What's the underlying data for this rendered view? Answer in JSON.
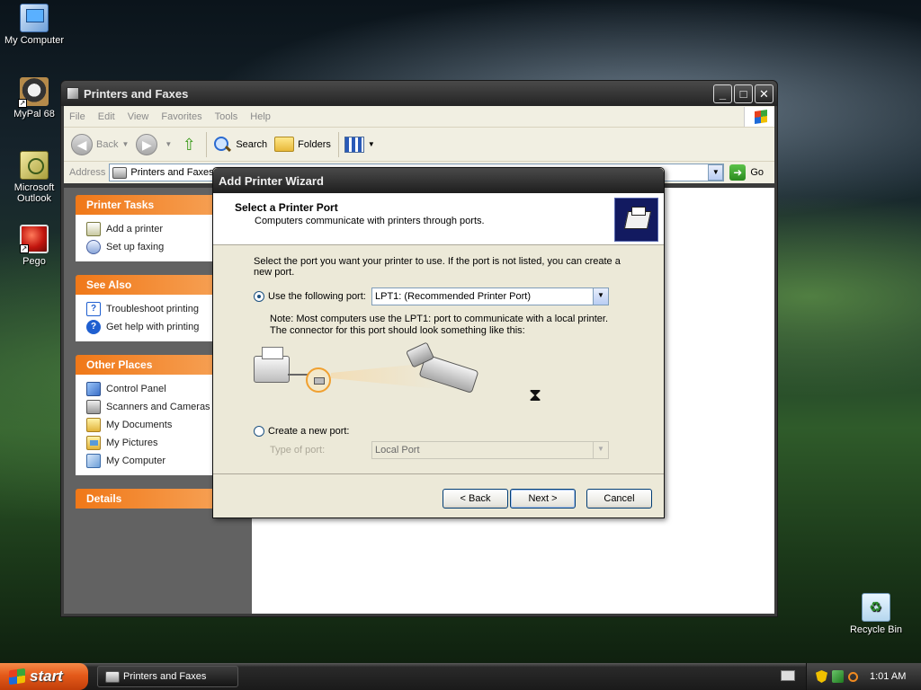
{
  "desktop": {
    "icons": [
      {
        "label": "My Computer"
      },
      {
        "label": "MyPal 68"
      },
      {
        "label": "Microsoft Outlook"
      },
      {
        "label": "Pego"
      },
      {
        "label": "Recycle Bin"
      }
    ]
  },
  "explorer": {
    "title": "Printers and Faxes",
    "menu": [
      "File",
      "Edit",
      "View",
      "Favorites",
      "Tools",
      "Help"
    ],
    "toolbar": {
      "back_label": "Back",
      "search_label": "Search",
      "folders_label": "Folders"
    },
    "address": {
      "label": "Address",
      "value": "Printers and Faxes",
      "go_label": "Go"
    },
    "panels": [
      {
        "title": "Printer Tasks",
        "items": [
          "Add a printer",
          "Set up faxing"
        ]
      },
      {
        "title": "See Also",
        "items": [
          "Troubleshoot printing",
          "Get help with printing"
        ]
      },
      {
        "title": "Other Places",
        "items": [
          "Control Panel",
          "Scanners and Cameras",
          "My Documents",
          "My Pictures",
          "My Computer"
        ]
      },
      {
        "title": "Details",
        "items": []
      }
    ]
  },
  "wizard": {
    "title": "Add Printer Wizard",
    "heading": "Select a Printer Port",
    "subheading": "Computers communicate with printers through ports.",
    "intro": "Select the port you want your printer to use.  If the port is not listed, you can create a new port.",
    "use_port_label": "Use the following port:",
    "port_value": "LPT1: (Recommended Printer Port)",
    "note": "Note: Most computers use the LPT1: port to communicate with a local printer. The connector for this port should look something like this:",
    "create_port_label": "Create a new port:",
    "type_label": "Type of port:",
    "type_value": "Local Port",
    "buttons": {
      "back": "< Back",
      "next": "Next >",
      "cancel": "Cancel"
    }
  },
  "taskbar": {
    "start_label": "start",
    "task_label": "Printers and Faxes",
    "clock": "1:01 AM"
  },
  "colors": {
    "panel_header": "#f07818",
    "titlebar": "#232323",
    "dialog_bg": "#ece9d8"
  }
}
